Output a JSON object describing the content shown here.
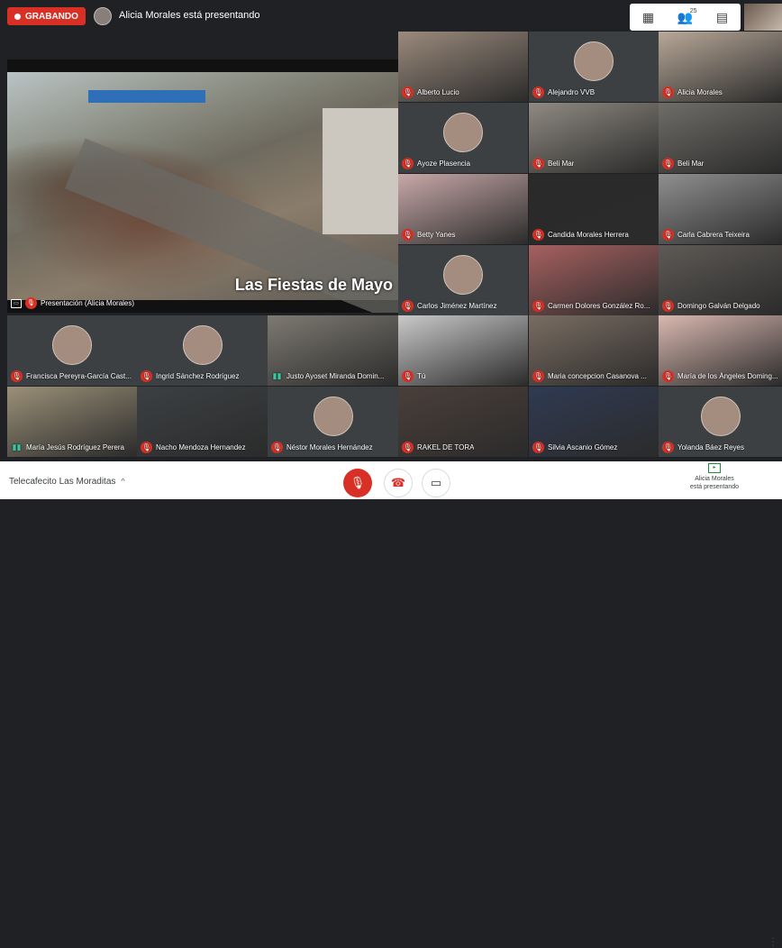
{
  "recording": {
    "label": "GRABANDO"
  },
  "presenter": {
    "text": "Alicia Morales está presentando"
  },
  "top_panel": {
    "participant_count": "25",
    "grid_icon": "grid-icon",
    "people_icon": "people-icon",
    "chat_icon": "chat-icon"
  },
  "presentation": {
    "title": "Las Fiestas de Mayo",
    "caption": "Presentación (Alicia Morales)"
  },
  "participants": [
    {
      "name": "Alberto Lucio",
      "mic": "off"
    },
    {
      "name": "Alejandro VVB",
      "mic": "off"
    },
    {
      "name": "Alicia Morales",
      "mic": "off"
    },
    {
      "name": "Ayoze Plasencia",
      "mic": "off"
    },
    {
      "name": "Beli Mar",
      "mic": "off"
    },
    {
      "name": "Beli Mar",
      "mic": "off"
    },
    {
      "name": "Betty Yanes",
      "mic": "off"
    },
    {
      "name": "Candida Morales Herrera",
      "mic": "off"
    },
    {
      "name": "Carla Cabrera Teixeira",
      "mic": "off"
    },
    {
      "name": "Carlos Jiménez Martínez",
      "mic": "off"
    },
    {
      "name": "Carmen Dolores González Ro...",
      "mic": "off"
    },
    {
      "name": "Domingo Galván Delgado",
      "mic": "off"
    },
    {
      "name": "Francisca Pereyra-García Cast...",
      "mic": "off"
    },
    {
      "name": "Ingrid Sánchez Rodríguez",
      "mic": "off"
    },
    {
      "name": "Justo Ayoset Miranda Domin...",
      "mic": "on"
    },
    {
      "name": "Tú",
      "mic": "off"
    },
    {
      "name": "Maria concepcion Casanova ...",
      "mic": "off"
    },
    {
      "name": "María de los Ángeles Doming...",
      "mic": "off"
    },
    {
      "name": "María Jesús Rodríguez Perera",
      "mic": "on"
    },
    {
      "name": "Nacho Mendoza Hernandez",
      "mic": "off"
    },
    {
      "name": "Néstor Morales Hernández",
      "mic": "off"
    },
    {
      "name": "RAKEL DE TORA",
      "mic": "off"
    },
    {
      "name": "Silvia Ascanio Gómez",
      "mic": "off"
    },
    {
      "name": "Yolanda Báez Reyes",
      "mic": "off"
    }
  ],
  "bottom": {
    "meeting_name": "Telecafecito Las Moraditas",
    "presenting_line1": "Alicia Morales",
    "presenting_line2": "está presentando"
  },
  "colors": {
    "record": "#d93025",
    "accent": "#34c7a0",
    "background": "#202124"
  }
}
